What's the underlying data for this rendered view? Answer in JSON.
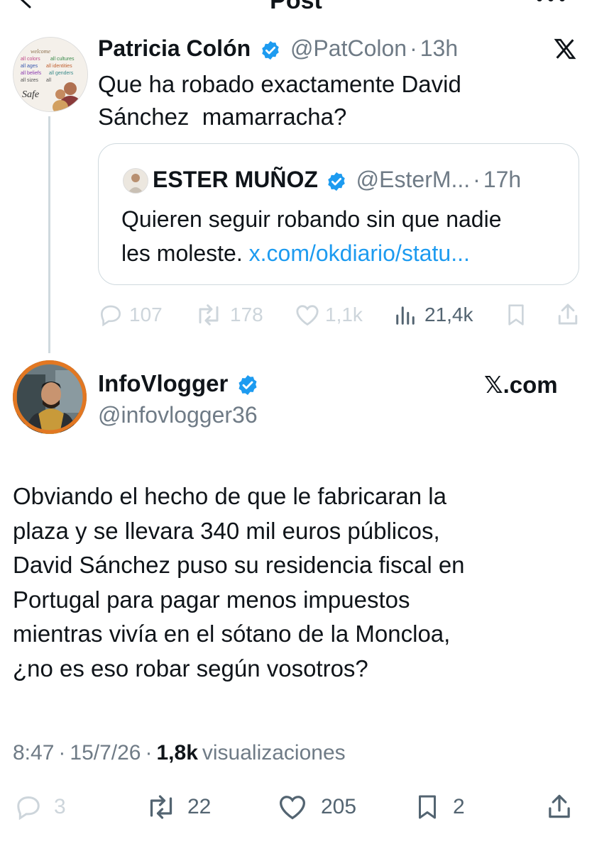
{
  "header": {
    "title": "Post"
  },
  "reply": {
    "name": "Patricia Colón",
    "handle": "@PatColon",
    "sep": "·",
    "time": "13h",
    "text_line1": "Que ha robado exactamente David",
    "text_line2": "Sánchez  mamarracha?",
    "avatar_words": [
      "welcome",
      "all colors",
      "all cultures",
      "all ages",
      "all identities",
      "all beliefs",
      "all genders",
      "all sizes",
      "all",
      "Safe"
    ],
    "quote": {
      "name": "ESTER MUÑOZ",
      "handle": "@EsterM...",
      "sep": "·",
      "time": "17h",
      "text_line1": "Quieren seguir robando sin que nadie",
      "text_line2_plain": "les moleste. ",
      "link": "x.com/okdiario/statu..."
    },
    "stats": {
      "replies": "107",
      "reposts": "178",
      "likes": "1,1k",
      "views": "21,4k"
    }
  },
  "main": {
    "name": "InfoVlogger",
    "handle": "@infovlogger36",
    "brand": "𝕏.com",
    "text_lines": [
      "Obviando el hecho de que le fabricaran la",
      "plaza y se llevara 340 mil euros públicos,",
      "David Sánchez puso su residencia fiscal en",
      "Portugal para pagar menos impuestos",
      "mientras vivía en el sótano de la Moncloa,",
      "¿no es eso robar según vosotros?"
    ],
    "time": "8:47",
    "date": "15/7/26",
    "sep": "·",
    "views_count": "1,8k",
    "views_label": "visualizaciones",
    "stats": {
      "replies": "3",
      "reposts": "22",
      "likes": "205",
      "bookmarks": "2"
    }
  },
  "colors": {
    "link": "#1d9bf0",
    "verified": "#1d9bf0",
    "muted": "#6f7b86",
    "avatar_ring": "#e27722"
  }
}
